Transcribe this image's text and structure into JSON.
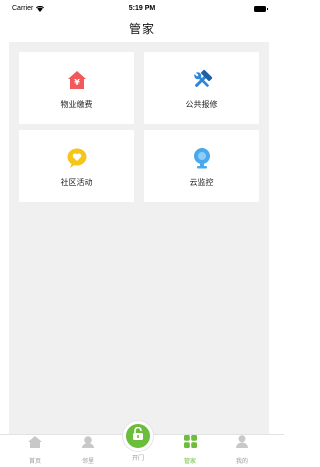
{
  "status_bar": {
    "carrier": "Carrier",
    "time": "5:19 PM"
  },
  "nav": {
    "title": "管家"
  },
  "cards": [
    {
      "label": "物业缴费",
      "icon": "house-yen-icon",
      "color": "#f05a5a"
    },
    {
      "label": "公共报修",
      "icon": "wrench-hammer-icon",
      "color": "#2f86d6"
    },
    {
      "label": "社区活动",
      "icon": "chat-heart-icon",
      "color": "#f5c518"
    },
    {
      "label": "云监控",
      "icon": "camera-icon",
      "color": "#4aa8ef"
    }
  ],
  "tabbar": {
    "items": [
      {
        "label": "首页",
        "icon": "home-icon"
      },
      {
        "label": "邻里",
        "icon": "neighbor-icon"
      },
      {
        "label": "开门",
        "icon": "unlock-icon"
      },
      {
        "label": "管家",
        "icon": "grid-icon",
        "active": true
      },
      {
        "label": "我的",
        "icon": "person-icon"
      }
    ],
    "active_color": "#6cbd3c",
    "inactive_color": "#999999"
  }
}
